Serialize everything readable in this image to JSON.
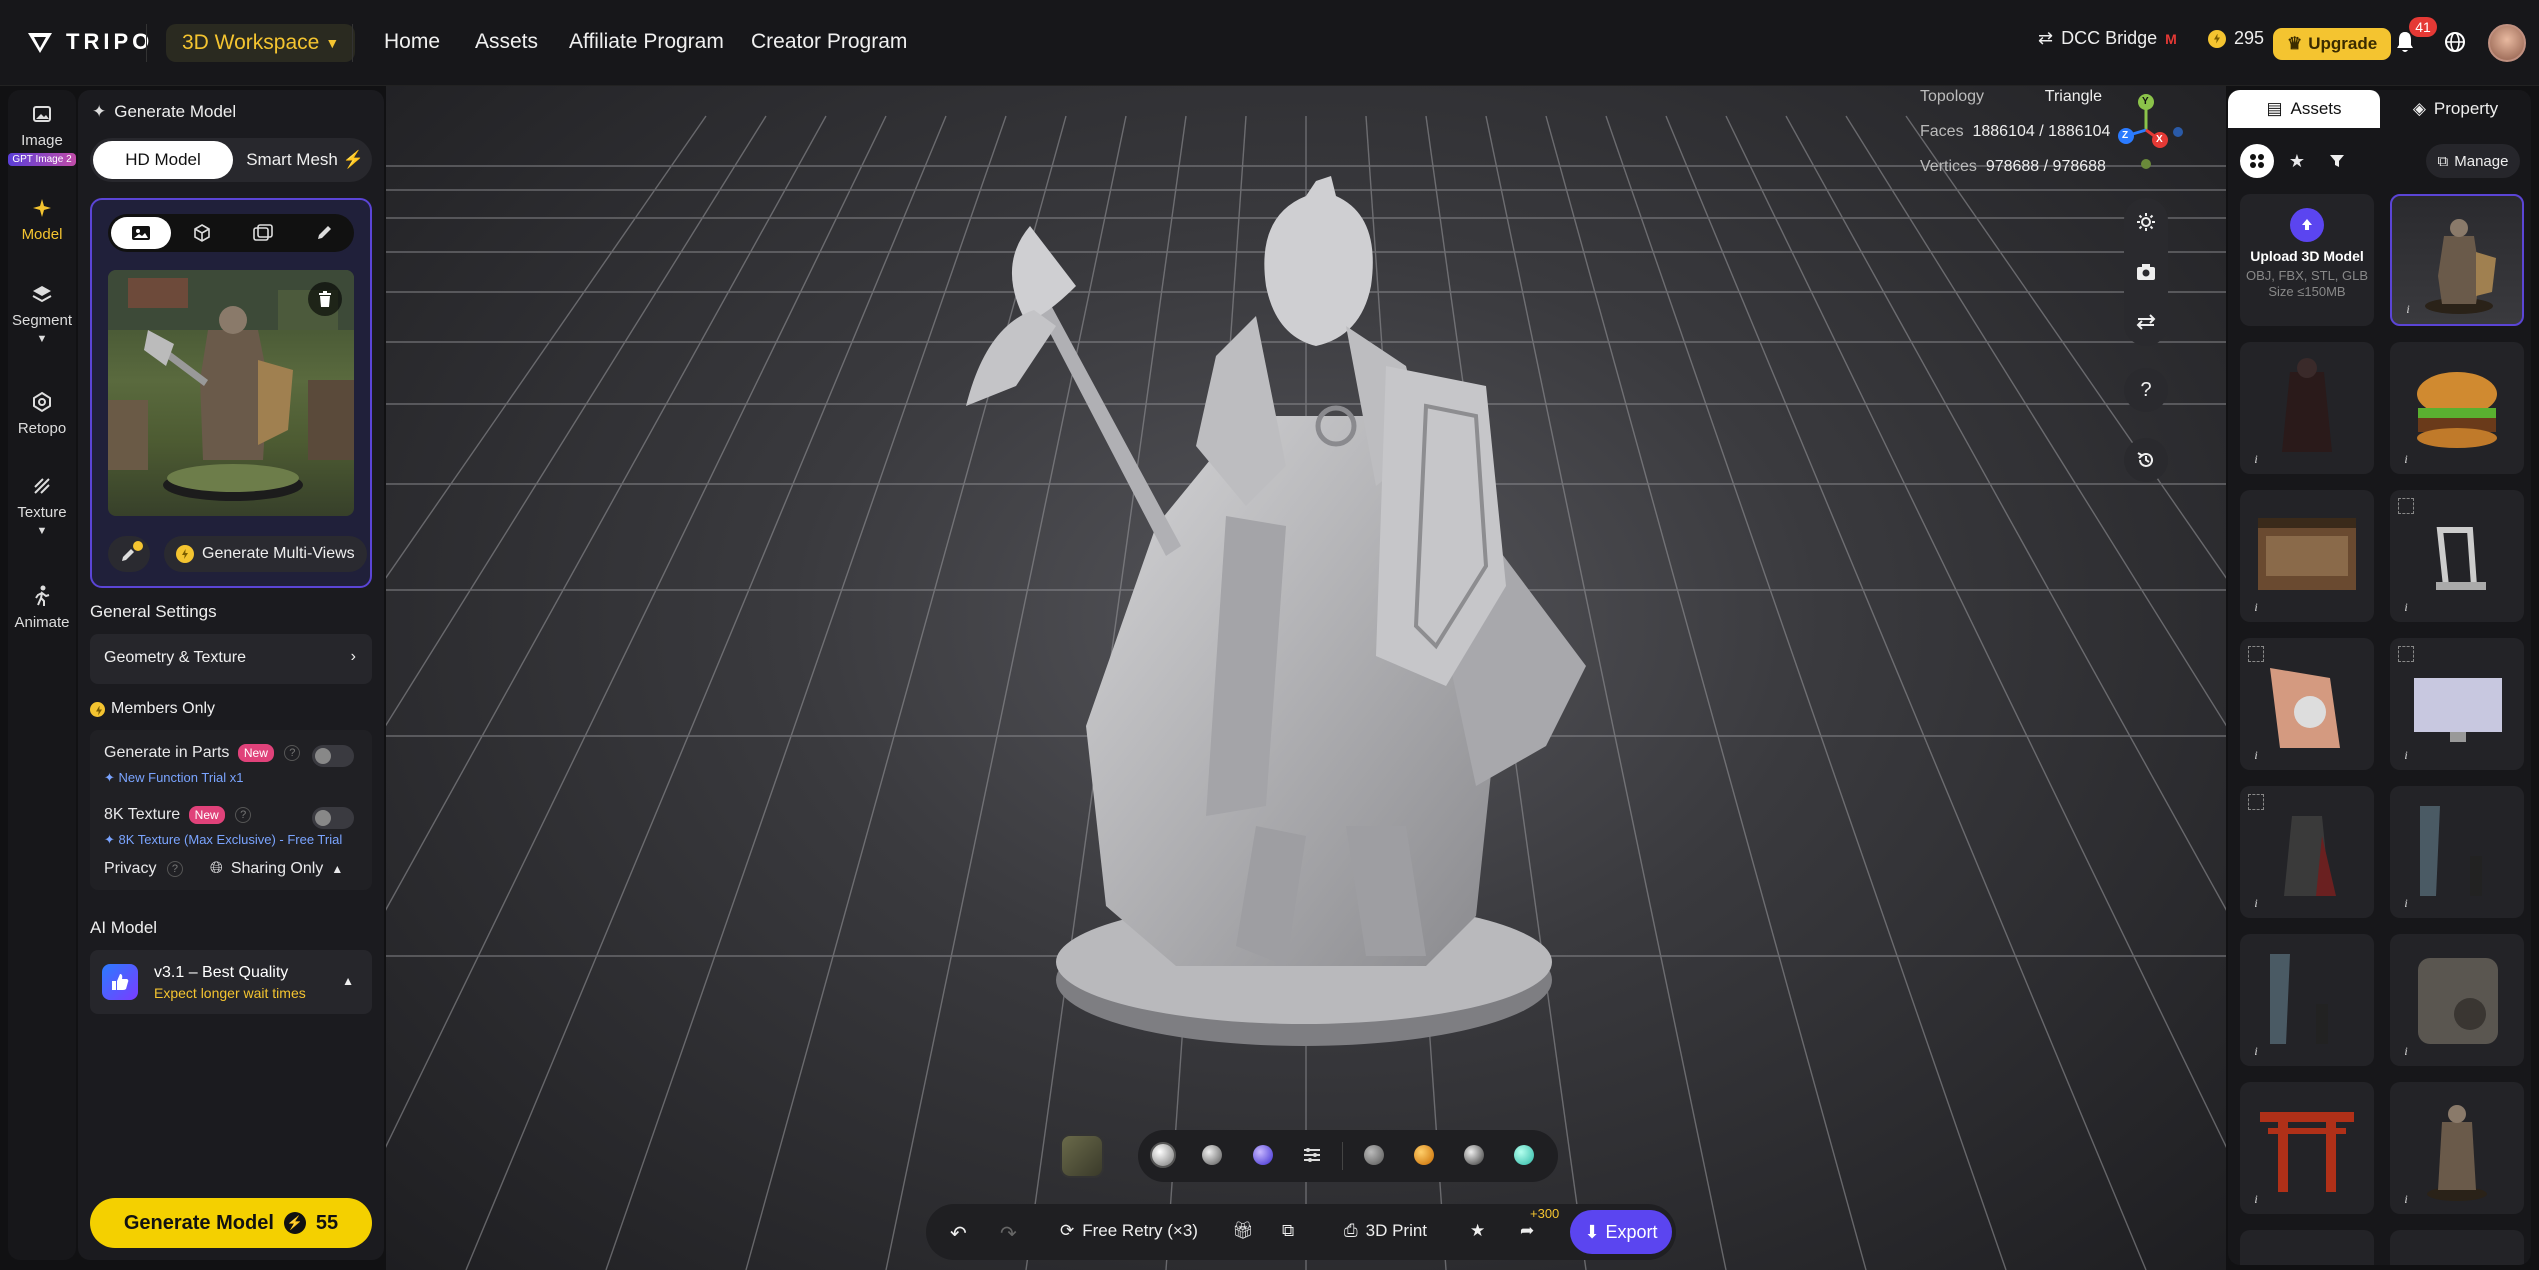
{
  "topbar": {
    "logo_text": "TRIPO",
    "workspace": "3D Workspace",
    "nav": [
      "Home",
      "Assets",
      "Affiliate Program",
      "Creator Program"
    ],
    "dcc_label": "DCC Bridge",
    "credits": "295",
    "upgrade": "Upgrade",
    "notifications": "41"
  },
  "rail": {
    "items": [
      {
        "label": "Image",
        "badge": "GPT Image 2"
      },
      {
        "label": "Model"
      },
      {
        "label": "Segment"
      },
      {
        "label": "Retopo"
      },
      {
        "label": "Texture"
      },
      {
        "label": "Animate"
      }
    ]
  },
  "panel": {
    "title": "Generate Model",
    "mode_on": "HD Model",
    "mode_off": "Smart Mesh",
    "multiview": "Generate Multi-Views",
    "general_settings": "General Settings",
    "geometry_texture": "Geometry & Texture",
    "members_only": "Members Only",
    "parts_label": "Generate in Parts",
    "parts_new": "New",
    "parts_sub": "New Function Trial x1",
    "texture_label": "8K Texture",
    "texture_new": "New",
    "texture_sub": "8K Texture (Max Exclusive) - Free Trial",
    "privacy": "Privacy",
    "privacy_value": "Sharing Only",
    "ai_model": "AI Model",
    "model_name": "v3.1 – Best Quality",
    "model_sub": "Expect longer wait times",
    "generate": "Generate Model",
    "generate_cost": "55"
  },
  "viewport": {
    "topology_label": "Topology",
    "topology_value": "Triangle",
    "faces_label": "Faces",
    "faces_value": "1886104 / 1886104",
    "vertices_label": "Vertices",
    "vertices_value": "978688 / 978688",
    "axes": {
      "y": "Y",
      "z": "Z",
      "x": "X"
    }
  },
  "bottombar": {
    "free_retry": "Free Retry (×3)",
    "print": "3D Print",
    "share_bonus": "+300",
    "export": "Export"
  },
  "assets": {
    "tab_assets": "Assets",
    "tab_property": "Property",
    "manage": "Manage",
    "upload_title": "Upload 3D Model",
    "upload_formats": "OBJ, FBX, STL, GLB",
    "upload_size": "Size ≤150MB"
  },
  "colors": {
    "accent": "#f4c430",
    "primary": "#5b45f0",
    "badge": "#e53935"
  }
}
